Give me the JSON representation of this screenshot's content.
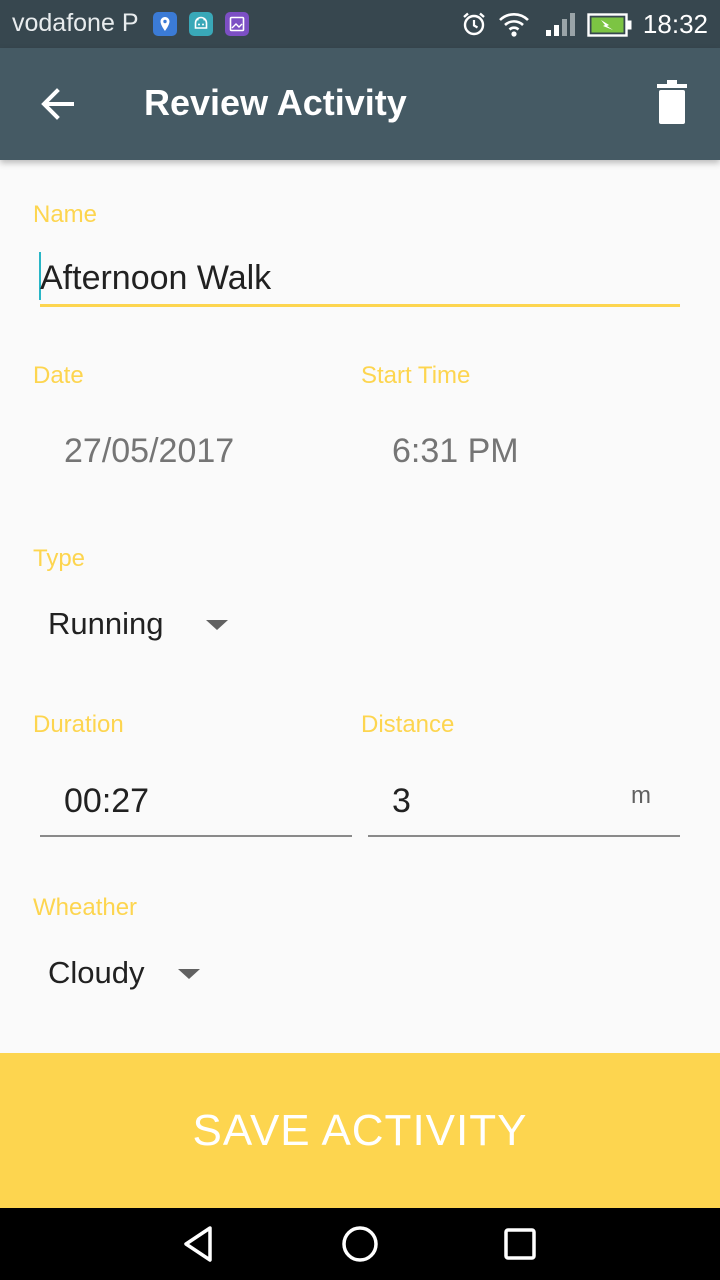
{
  "status_bar": {
    "carrier": "vodafone P",
    "time": "18:32",
    "notification_icons": [
      "location-icon",
      "android-icon",
      "image-icon"
    ],
    "notification_colors": [
      "#3b7bd6",
      "#39a8b8",
      "#7c4fc4"
    ]
  },
  "app_bar": {
    "title": "Review Activity",
    "back_icon": "arrow-back-icon",
    "delete_icon": "trash-icon",
    "color": "#455a64"
  },
  "form": {
    "name_label": "Name",
    "name_value": "Afternoon Walk",
    "date_label": "Date",
    "date_value": "27/05/2017",
    "start_time_label": "Start Time",
    "start_time_value": "6:31 PM",
    "type_label": "Type",
    "type_value": "Running",
    "duration_label": "Duration",
    "duration_value": "00:27",
    "distance_label": "Distance",
    "distance_value": "3",
    "distance_unit": "m",
    "weather_label": "Wheather",
    "weather_value": "Cloudy",
    "accent_color": "#fdd54f"
  },
  "save_button": {
    "label": "SAVE ACTIVITY",
    "color": "#fdd54f"
  },
  "nav_bar": {
    "icons": [
      "back-triangle-icon",
      "home-circle-icon",
      "recents-square-icon"
    ]
  }
}
